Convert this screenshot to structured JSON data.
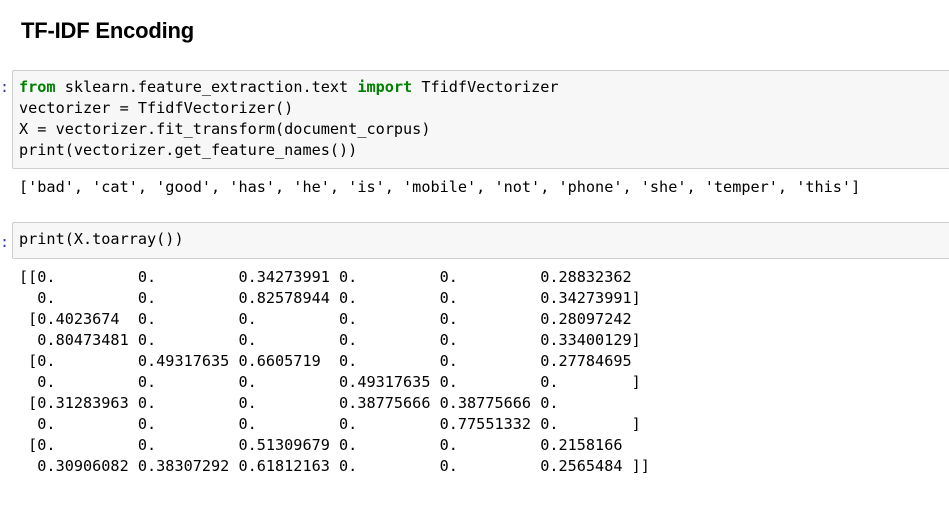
{
  "heading": "TF-IDF Encoding",
  "cell1": {
    "prompt": ":",
    "line1_kw1": "from",
    "line1_mod": " sklearn.feature_extraction.text ",
    "line1_kw2": "import",
    "line1_rest": " TfidfVectorizer",
    "line2": "vectorizer = TfidfVectorizer()",
    "line3": "X = vectorizer.fit_transform(document_corpus)",
    "line4": "print(vectorizer.get_feature_names())"
  },
  "output1": "['bad', 'cat', 'good', 'has', 'he', 'is', 'mobile', 'not', 'phone', 'she', 'temper', 'this']",
  "cell2": {
    "prompt": ":",
    "line1": "print(X.toarray())"
  },
  "output2": [
    "[[0.         0.         0.34273991 0.         0.         0.28832362",
    "  0.         0.         0.82578944 0.         0.         0.34273991]",
    " [0.4023674  0.         0.         0.         0.         0.28097242",
    "  0.80473481 0.         0.         0.         0.         0.33400129]",
    " [0.         0.49317635 0.6605719  0.         0.         0.27784695",
    "  0.         0.         0.         0.49317635 0.         0.        ]",
    " [0.31283963 0.         0.         0.38775666 0.38775666 0.",
    "  0.         0.         0.         0.         0.77551332 0.        ]",
    " [0.         0.         0.51309679 0.         0.         0.2158166",
    "  0.30906082 0.38307292 0.61812163 0.         0.         0.2565484 ]]"
  ]
}
